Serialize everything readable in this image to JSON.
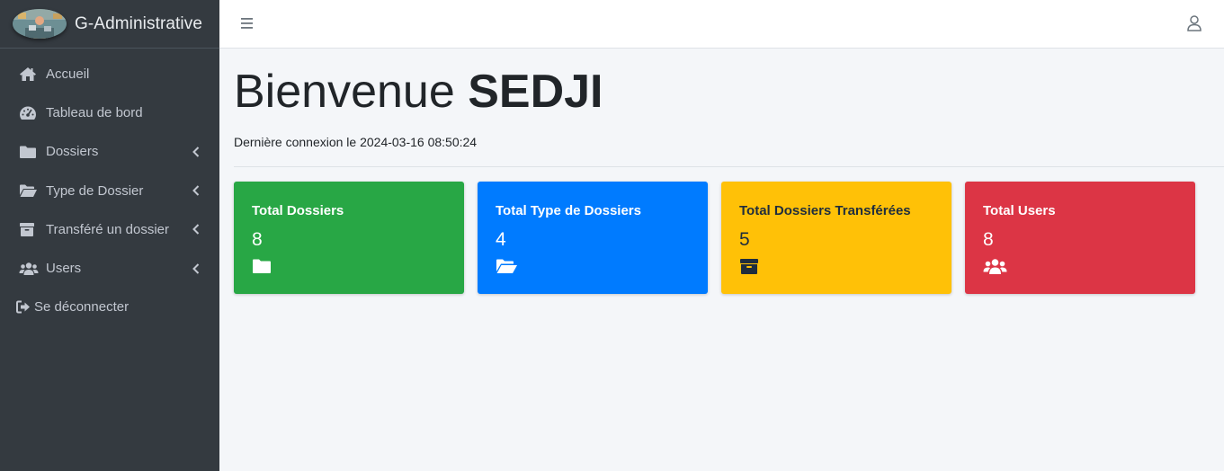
{
  "brand": {
    "name": "G-Administrative"
  },
  "sidebar": {
    "items": [
      {
        "label": "Accueil",
        "icon": "home-icon",
        "has_submenu": false
      },
      {
        "label": "Tableau de bord",
        "icon": "dashboard-icon",
        "has_submenu": false
      },
      {
        "label": "Dossiers",
        "icon": "folder-icon",
        "has_submenu": true
      },
      {
        "label": "Type de Dossier",
        "icon": "folder-open-icon",
        "has_submenu": true
      },
      {
        "label": "Transféré un dossier",
        "icon": "archive-icon",
        "has_submenu": true
      },
      {
        "label": "Users",
        "icon": "users-icon",
        "has_submenu": true
      },
      {
        "label": "Se déconnecter",
        "icon": "sign-out-icon",
        "has_submenu": false
      }
    ]
  },
  "header": {
    "menu_icon": "hamburger-icon",
    "user_icon": "user-icon"
  },
  "main": {
    "welcome_prefix": "Bienvenue",
    "username": "SEDJI",
    "last_login_label": "Dernière connexion le",
    "last_login_value": "2024-03-16 08:50:24",
    "cards": [
      {
        "title": "Total Dossiers",
        "value": "8",
        "icon": "folder-icon",
        "color": "#28a745"
      },
      {
        "title": "Total Type de Dossiers",
        "value": "4",
        "icon": "folder-open-icon",
        "color": "#007bff"
      },
      {
        "title": "Total Dossiers Transférées",
        "value": "5",
        "icon": "archive-icon",
        "color": "#ffc107"
      },
      {
        "title": "Total Users",
        "value": "8",
        "icon": "users-icon",
        "color": "#dc3545"
      }
    ]
  },
  "colors": {
    "sidebar_bg": "#343a40",
    "content_bg": "#f4f6f9",
    "sidebar_text": "#c2c7d0"
  }
}
